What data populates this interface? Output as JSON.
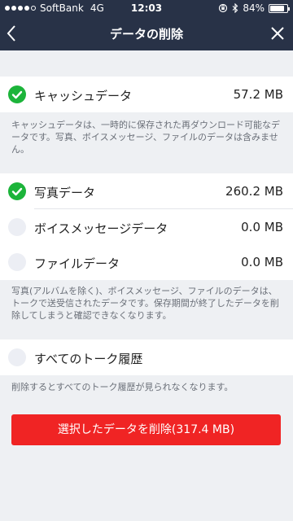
{
  "status": {
    "carrier": "SoftBank",
    "network": "4G",
    "time": "12:03",
    "battery": "84%",
    "battery_level": 0.84
  },
  "nav": {
    "title": "データの削除",
    "back_icon": "chevron-left-icon",
    "close_icon": "close-icon"
  },
  "cache": {
    "label": "キャッシュデータ",
    "size": "57.2 MB",
    "checked": true,
    "note": "キャッシュデータは、一時的に保存された再ダウンロード可能なデータです。写真、ボイスメッセージ、ファイルのデータは含みません。"
  },
  "media": {
    "items": [
      {
        "label": "写真データ",
        "size": "260.2 MB",
        "checked": true
      },
      {
        "label": "ボイスメッセージデータ",
        "size": "0.0 MB",
        "checked": false
      },
      {
        "label": "ファイルデータ",
        "size": "0.0 MB",
        "checked": false
      }
    ],
    "note": "写真(アルバムを除く)、ボイスメッセージ、ファイルのデータは、トークで送受信されたデータです。保存期間が終了したデータを削除してしまうと確認できなくなります。"
  },
  "history": {
    "label": "すべてのトーク履歴",
    "checked": false,
    "note": "削除するとすべてのトーク履歴が見られなくなります。"
  },
  "delete_button": "選択したデータを削除(317.4 MB)",
  "colors": {
    "header_bg": "#283247",
    "check_on": "#1cb43a",
    "delete_btn": "#f02424"
  }
}
